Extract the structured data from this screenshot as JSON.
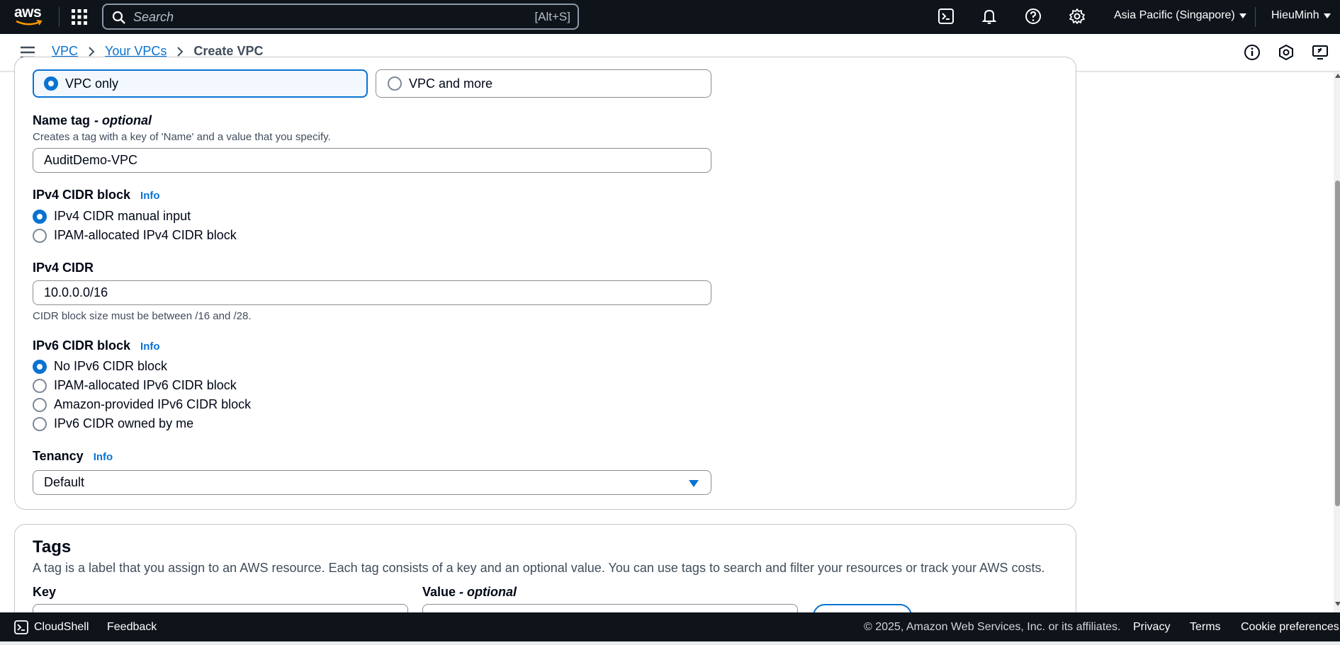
{
  "topnav": {
    "logo": "aws",
    "search_placeholder": "Search",
    "search_shortcut": "[Alt+S]",
    "region": "Asia Pacific (Singapore)",
    "user": "HieuMinh",
    "icons": [
      "cloudshell-icon",
      "bell-icon",
      "help-icon",
      "gear-icon"
    ]
  },
  "breadcrumb": {
    "items": [
      "VPC",
      "Your VPCs"
    ],
    "current": "Create VPC"
  },
  "resource_tiles": {
    "selected": "VPC only",
    "other": "VPC and more"
  },
  "name_tag": {
    "label": "Name tag",
    "optional": "- optional",
    "description": "Creates a tag with a key of 'Name' and a value that you specify.",
    "value": "AuditDemo-VPC"
  },
  "ipv4_block": {
    "label": "IPv4 CIDR block",
    "info": "Info",
    "options": [
      "IPv4 CIDR manual input",
      "IPAM-allocated IPv4 CIDR block"
    ],
    "selected_index": 0
  },
  "ipv4_cidr": {
    "label": "IPv4 CIDR",
    "value": "10.0.0.0/16",
    "hint": "CIDR block size must be between /16 and /28."
  },
  "ipv6_block": {
    "label": "IPv6 CIDR block",
    "info": "Info",
    "options": [
      "No IPv6 CIDR block",
      "IPAM-allocated IPv6 CIDR block",
      "Amazon-provided IPv6 CIDR block",
      "IPv6 CIDR owned by me"
    ],
    "selected_index": 0
  },
  "tenancy": {
    "label": "Tenancy",
    "info": "Info",
    "value": "Default"
  },
  "tags": {
    "title": "Tags",
    "description": "A tag is a label that you assign to an AWS resource. Each tag consists of a key and an optional value. You can use tags to search and filter your resources or track your AWS costs.",
    "key_label": "Key",
    "value_label": "Value",
    "value_optional": "- optional"
  },
  "footer": {
    "cloudshell": "CloudShell",
    "feedback": "Feedback",
    "copyright": "© 2025, Amazon Web Services, Inc. or its affiliates.",
    "privacy": "Privacy",
    "terms": "Terms",
    "cookies": "Cookie preferences"
  },
  "colors": {
    "nav_bg": "#0f141a",
    "accent": "#0972d3",
    "selected_tile_bg": "#f2f8fd",
    "border": "#8c8c94"
  }
}
